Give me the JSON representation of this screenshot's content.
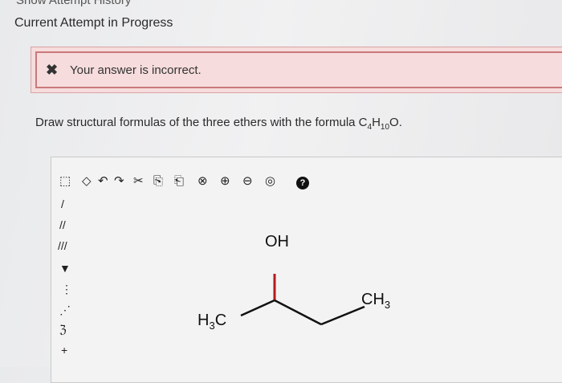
{
  "header": {
    "cutoff_text": "Show Attempt History",
    "title": "Current Attempt in Progress"
  },
  "feedback": {
    "icon": "x-icon",
    "message": "Your answer is incorrect."
  },
  "question": {
    "text_before": "Draw structural formulas of the three ethers with the formula C",
    "sub1": "4",
    "h": "H",
    "sub2": "10",
    "text_after": "O."
  },
  "sketcher": {
    "toolbar": [
      {
        "name": "select-icon",
        "glyph": "⬚"
      },
      {
        "name": "erase-icon",
        "glyph": "◇"
      },
      {
        "name": "undo-icon",
        "glyph": "↶"
      },
      {
        "name": "redo-icon",
        "glyph": "↷"
      },
      {
        "name": "cut-icon",
        "glyph": "✂"
      },
      {
        "name": "copy-icon",
        "glyph": "⎘"
      },
      {
        "name": "paste-icon",
        "glyph": "⎗"
      },
      {
        "name": "clear-icon",
        "glyph": "⊗"
      },
      {
        "name": "zoom-in-icon",
        "glyph": "⊕"
      },
      {
        "name": "zoom-out-icon",
        "glyph": "⊖"
      },
      {
        "name": "zoom-fit-icon",
        "glyph": "◎"
      },
      {
        "name": "help-icon",
        "glyph": "?"
      }
    ],
    "side_tools": [
      {
        "name": "single-bond-icon",
        "glyph": "/"
      },
      {
        "name": "double-bond-icon",
        "glyph": "//"
      },
      {
        "name": "triple-bond-icon",
        "glyph": "///"
      },
      {
        "name": "wedge-bond-icon",
        "glyph": "▼"
      },
      {
        "name": "hash-bond-icon",
        "glyph": "⋮"
      },
      {
        "name": "dashed-bond-icon",
        "glyph": "⋰"
      },
      {
        "name": "charge-icon",
        "glyph": "ℨ"
      },
      {
        "name": "plus-charge-icon",
        "glyph": "+"
      }
    ],
    "molecule": {
      "oh_label": "OH",
      "left_label": "H",
      "left_sub": "3",
      "left_c": "C",
      "right_label": "CH",
      "right_sub": "3"
    }
  }
}
